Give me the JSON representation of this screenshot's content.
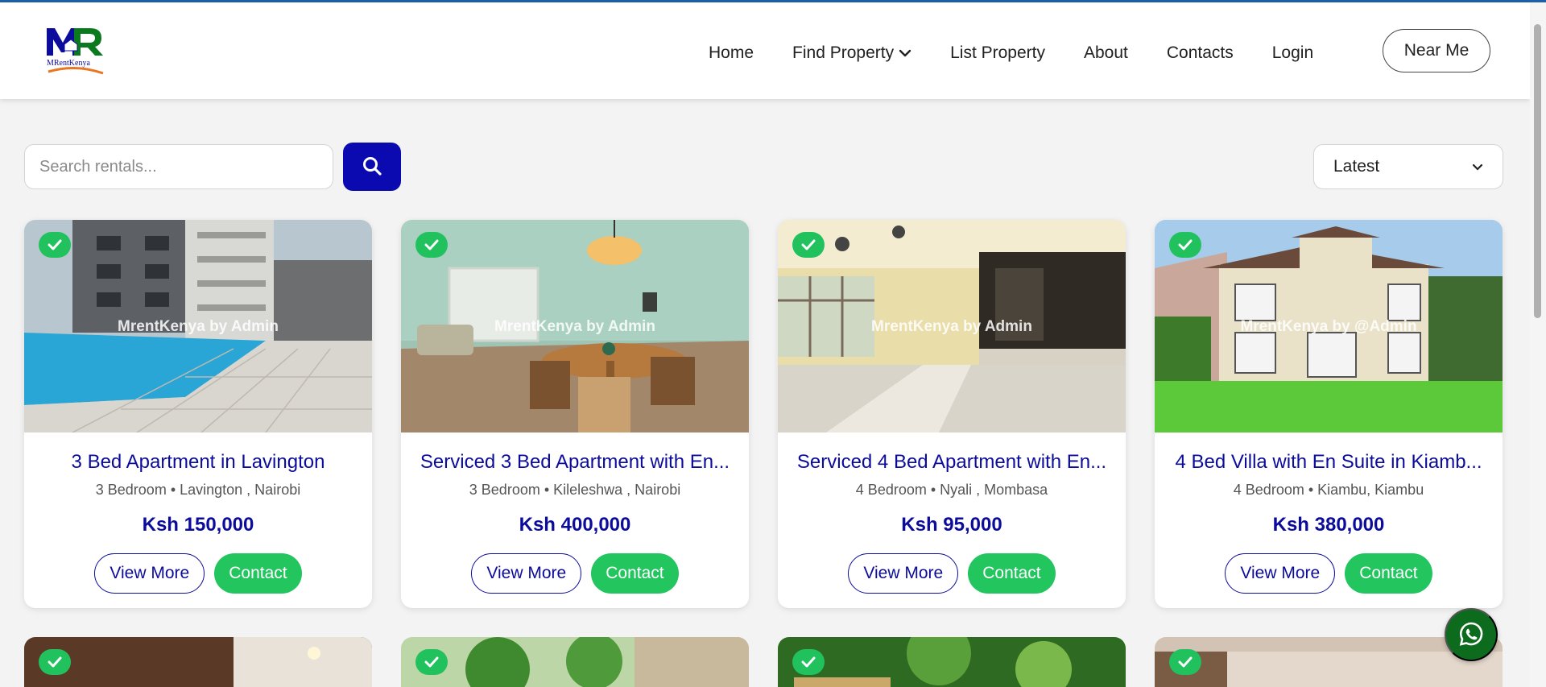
{
  "brand": {
    "name": "MRentKenya",
    "tagline": "MRentKenya"
  },
  "nav": {
    "items": [
      {
        "label": "Home"
      },
      {
        "label": "Find Property",
        "has_dropdown": true
      },
      {
        "label": "List Property"
      },
      {
        "label": "About"
      },
      {
        "label": "Contacts"
      },
      {
        "label": "Login"
      }
    ],
    "near_me": "Near Me"
  },
  "search": {
    "placeholder": "Search rentals...",
    "value": ""
  },
  "sort": {
    "selected": "Latest"
  },
  "colors": {
    "primary": "#0c0c9c",
    "search_button": "#0a0ab0",
    "contact_green": "#22c55e",
    "verified_green": "#21c15e",
    "whatsapp": "#0d6b1e"
  },
  "listings": [
    {
      "title": "3 Bed Apartment in Lavington",
      "meta": "3 Bedroom • Lavington , Nairobi",
      "price": "Ksh 150,000",
      "watermark": "MrentKenya by Admin",
      "verified": true,
      "view_label": "View More",
      "contact_label": "Contact"
    },
    {
      "title": "Serviced 3 Bed Apartment with En...",
      "meta": "3 Bedroom • Kileleshwa , Nairobi",
      "price": "Ksh 400,000",
      "watermark": "MrentKenya by Admin",
      "verified": true,
      "view_label": "View More",
      "contact_label": "Contact"
    },
    {
      "title": "Serviced 4 Bed Apartment with En...",
      "meta": "4 Bedroom • Nyali , Mombasa",
      "price": "Ksh 95,000",
      "watermark": "MrentKenya by Admin",
      "verified": true,
      "view_label": "View More",
      "contact_label": "Contact"
    },
    {
      "title": "4 Bed Villa with En Suite in Kiamb...",
      "meta": "4 Bedroom • Kiambu, Kiambu",
      "price": "Ksh 380,000",
      "watermark": "MrentKenya by @Admin",
      "verified": true,
      "view_label": "View More",
      "contact_label": "Contact"
    }
  ],
  "icons": {
    "search": "search-icon",
    "verified": "check-icon",
    "whatsapp": "whatsapp-icon",
    "dropdown": "chevron-down-icon"
  }
}
